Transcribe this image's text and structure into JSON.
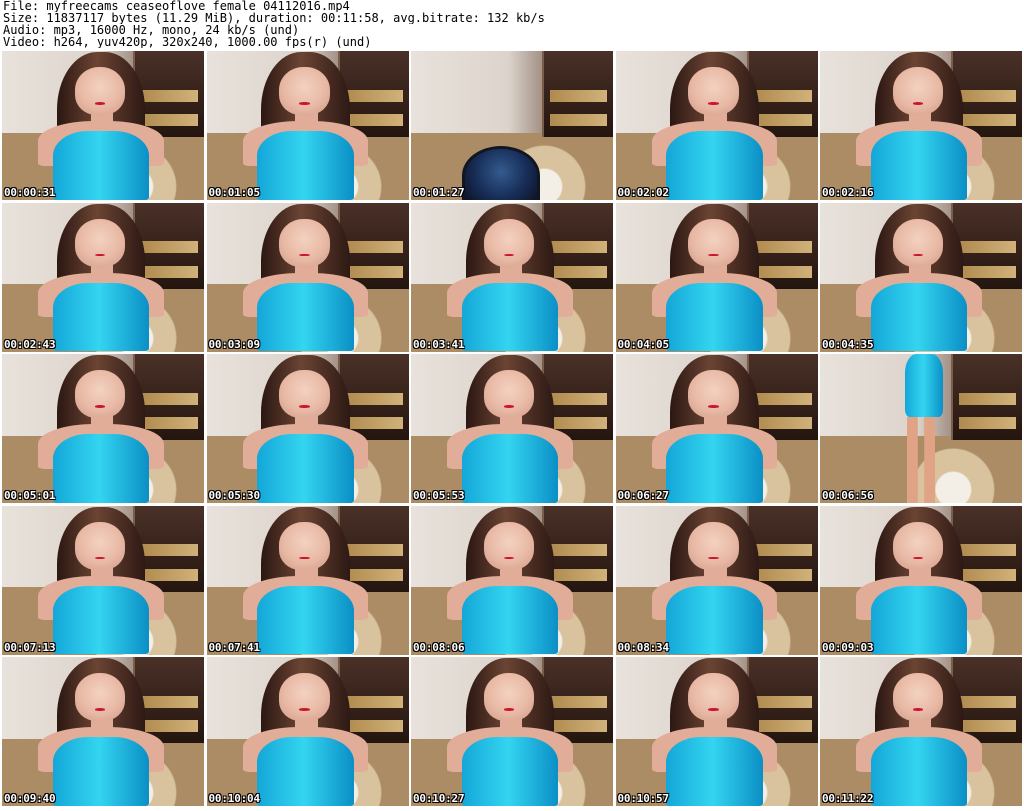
{
  "header": {
    "file_line": "File: myfreecams_ceaseoflove_female_04112016.mp4",
    "size_line": "Size: 11837117 bytes (11.29 MiB), duration: 00:11:58, avg.bitrate: 132 kb/s",
    "audio_line": "Audio: mp3, 16000 Hz, mono, 24 kb/s (und)",
    "video_line": "Video: h264, yuv420p, 320x240, 1000.00 fps(r) (und)"
  },
  "thumbnails": [
    {
      "time": "00:00:31"
    },
    {
      "time": "00:01:05"
    },
    {
      "time": "00:01:27"
    },
    {
      "time": "00:02:02"
    },
    {
      "time": "00:02:16"
    },
    {
      "time": "00:02:43"
    },
    {
      "time": "00:03:09"
    },
    {
      "time": "00:03:41"
    },
    {
      "time": "00:04:05"
    },
    {
      "time": "00:04:35"
    },
    {
      "time": "00:05:01"
    },
    {
      "time": "00:05:30"
    },
    {
      "time": "00:05:53"
    },
    {
      "time": "00:06:27"
    },
    {
      "time": "00:06:56"
    },
    {
      "time": "00:07:13"
    },
    {
      "time": "00:07:41"
    },
    {
      "time": "00:08:06"
    },
    {
      "time": "00:08:34"
    },
    {
      "time": "00:09:03"
    },
    {
      "time": "00:09:40"
    },
    {
      "time": "00:10:04"
    },
    {
      "time": "00:10:27"
    },
    {
      "time": "00:10:57"
    },
    {
      "time": "00:11:22"
    }
  ]
}
